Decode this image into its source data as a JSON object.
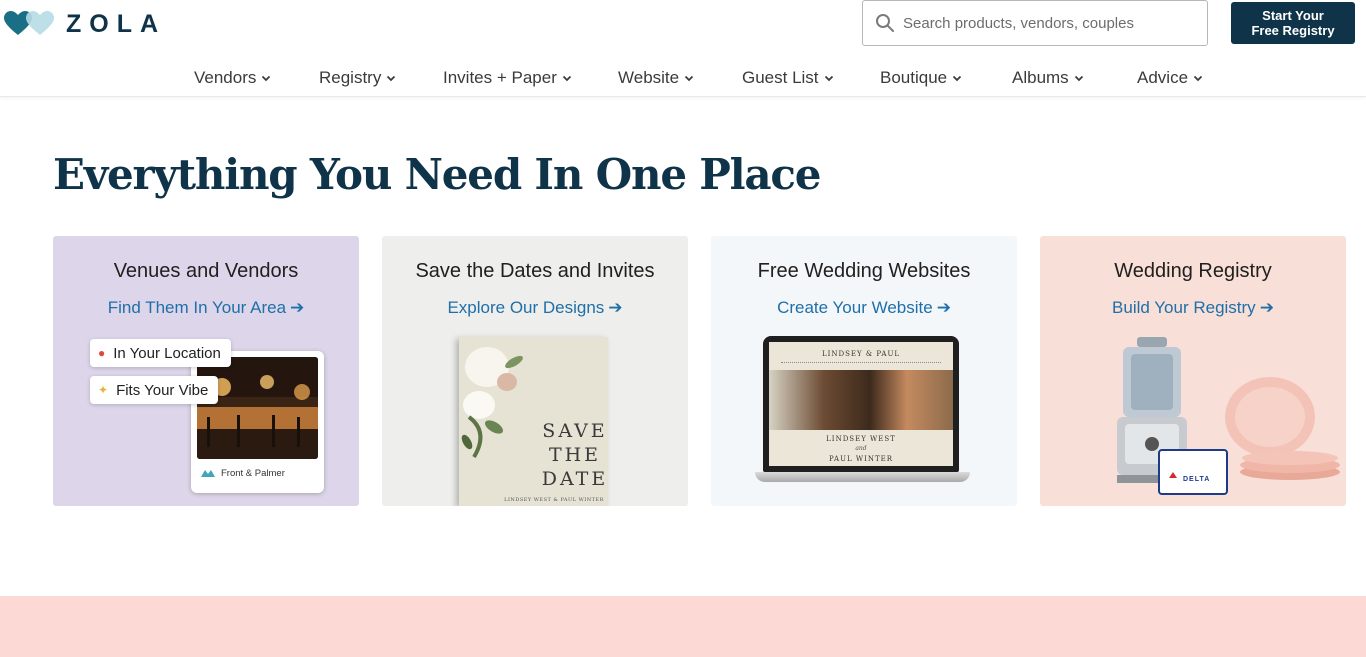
{
  "brand": {
    "logo_text": "ZOLA",
    "colors": {
      "navy": "#0f3349",
      "link": "#1f6fa8",
      "heart_teal": "#1a6f86",
      "heart_light": "#b5dbe6"
    }
  },
  "search": {
    "placeholder": "Search products, vendors, couples",
    "icon": "search-icon"
  },
  "cta": {
    "line1": "Start Your",
    "line2": "Free Registry"
  },
  "nav": {
    "items": [
      {
        "label": "Vendors"
      },
      {
        "label": "Registry"
      },
      {
        "label": "Invites + Paper"
      },
      {
        "label": "Website"
      },
      {
        "label": "Guest List"
      },
      {
        "label": "Boutique"
      },
      {
        "label": "Albums"
      },
      {
        "label": "Advice"
      }
    ]
  },
  "hero": {
    "title": "Everything You Need In One Place"
  },
  "cards": [
    {
      "title": "Venues and Vendors",
      "link": "Find Them In Your Area",
      "bg": "#ddd6ea",
      "pills": [
        "In Your Location",
        "Fits Your Vibe"
      ],
      "venue_name": "Front & Palmer"
    },
    {
      "title": "Save the Dates and Invites",
      "link": "Explore Our Designs",
      "bg": "#eeeeec",
      "card_text": {
        "line1": "SAVE",
        "line2": "THE",
        "line3": "DATE",
        "names": "LINDSEY WEST & PAUL WINTER"
      }
    },
    {
      "title": "Free Wedding Websites",
      "link": "Create Your Website",
      "bg": "#f3f7fa",
      "site_header": "LINDSEY & PAUL",
      "site_caption": "LINDSEY WEST",
      "site_caption_and": "and",
      "site_caption_2": "PAUL WINTER"
    },
    {
      "title": "Wedding Registry",
      "link": "Build Your Registry",
      "bg": "#f8dfd8",
      "gift_card": "DELTA"
    }
  ],
  "arrow_glyph": "➔"
}
